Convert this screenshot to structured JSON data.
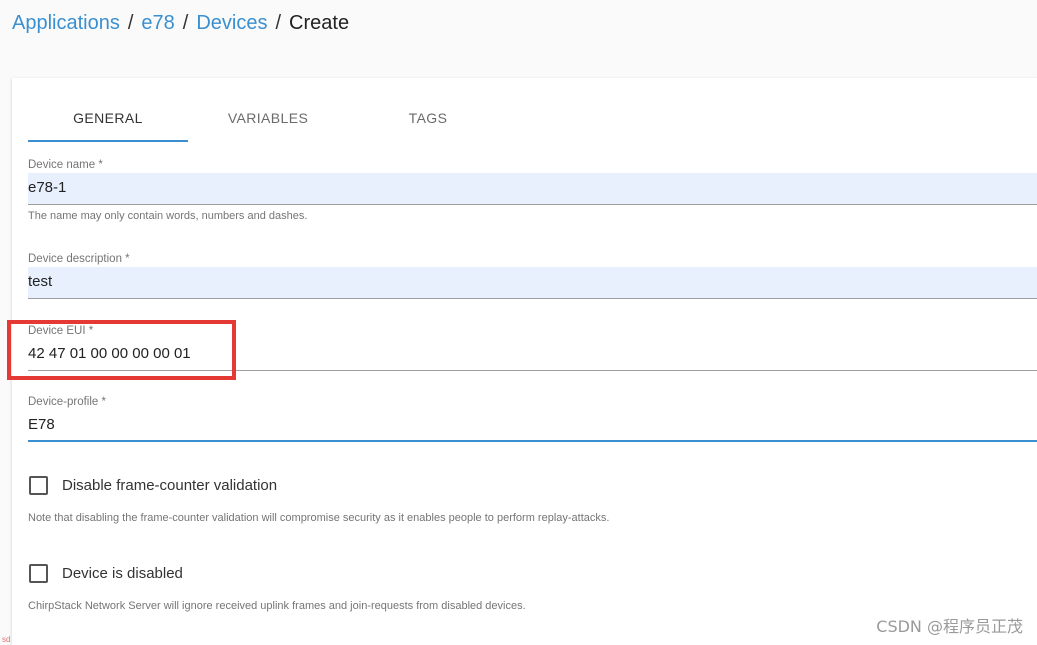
{
  "breadcrumb": {
    "applications": "Applications",
    "app": "e78",
    "devices": "Devices",
    "current": "Create",
    "separator": "/"
  },
  "tabs": [
    {
      "label": "GENERAL",
      "active": true
    },
    {
      "label": "VARIABLES",
      "active": false
    },
    {
      "label": "TAGS",
      "active": false
    }
  ],
  "form": {
    "required_mark": "*",
    "device_name": {
      "label": "Device name",
      "value": "e78-1",
      "helper": "The name may only contain words, numbers and dashes."
    },
    "device_description": {
      "label": "Device description",
      "value": "test"
    },
    "device_eui": {
      "label": "Device EUI",
      "value": "42 47 01 00 00 00 00 01"
    },
    "device_profile": {
      "label": "Device-profile",
      "value": "E78"
    },
    "disable_fcnt": {
      "label": "Disable frame-counter validation",
      "checked": false,
      "note": "Note that disabling the frame-counter validation will compromise security as it enables people to perform replay-attacks."
    },
    "device_disabled": {
      "label": "Device is disabled",
      "checked": false,
      "note": "ChirpStack Network Server will ignore received uplink frames and join-requests from disabled devices."
    }
  },
  "colors": {
    "accent": "#3a8fd0",
    "highlight": "#e53935",
    "autofill": "#e8f0fe"
  },
  "watermark": "CSDN @程序员正茂",
  "corner_mark": "sd"
}
